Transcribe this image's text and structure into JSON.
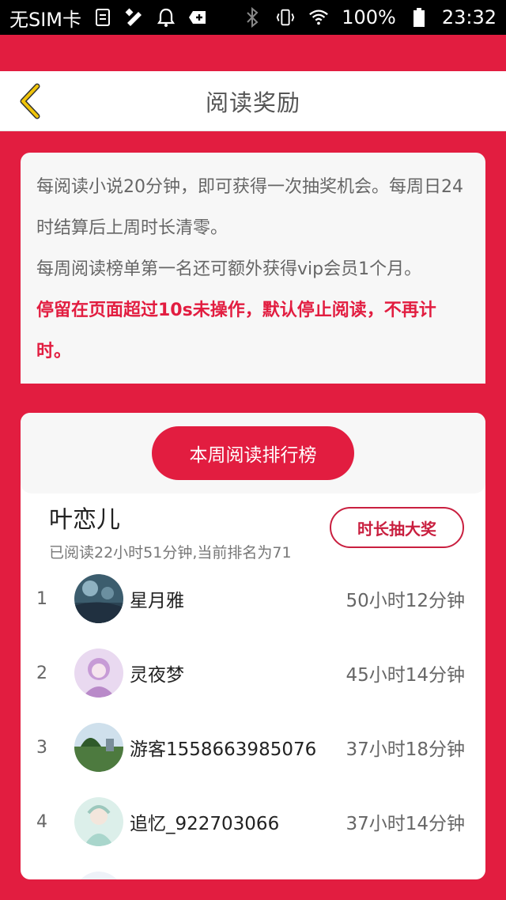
{
  "status_bar": {
    "carrier": "无SIM卡",
    "battery": "100%",
    "time": "23:32"
  },
  "nav": {
    "title": "阅读奖励"
  },
  "rules": {
    "line1": "每阅读小说20分钟，即可获得一次抽奖机会。每周日24时结算后上周时长清零。",
    "line2": "每周阅读榜单第一名还可额外获得vip会员1个月。",
    "warning": "停留在页面超过10s未操作，默认停止阅读，不再计时。"
  },
  "ranking": {
    "title": "本周阅读排行榜",
    "me": {
      "name": "叶恋儿",
      "info": "已阅读22小时51分钟,当前排名为71",
      "draw_label": "时长抽大奖"
    },
    "rows": [
      {
        "rank": "1",
        "name": "星月雅",
        "time": "50小时12分钟"
      },
      {
        "rank": "2",
        "name": "灵夜梦",
        "time": "45小时14分钟"
      },
      {
        "rank": "3",
        "name": "游客1558663985076",
        "time": "37小时18分钟"
      },
      {
        "rank": "4",
        "name": "追忆_922703066",
        "time": "37小时14分钟"
      }
    ]
  },
  "colors": {
    "accent": "#e21d40",
    "back_arrow": "#f0c40a"
  }
}
